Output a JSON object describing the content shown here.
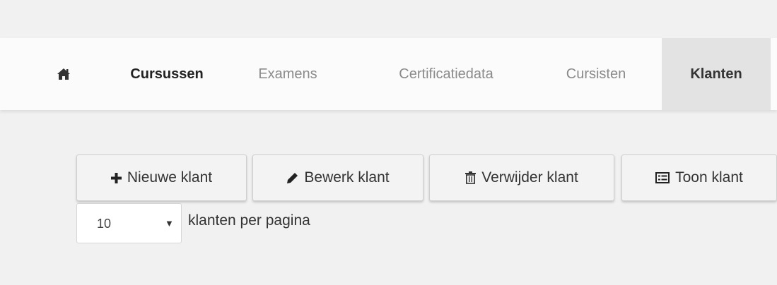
{
  "nav": {
    "home_icon": "home-icon",
    "items": [
      {
        "label": "Cursussen",
        "state": "emphasized"
      },
      {
        "label": "Examens",
        "state": "normal"
      },
      {
        "label": "Certificatiedata",
        "state": "normal"
      },
      {
        "label": "Cursisten",
        "state": "normal"
      },
      {
        "label": "Klanten",
        "state": "active"
      }
    ]
  },
  "toolbar": {
    "new_label": "Nieuwe klant",
    "new_icon": "plus-icon",
    "edit_label": "Bewerk klant",
    "edit_icon": "pencil-icon",
    "delete_label": "Verwijder klant",
    "delete_icon": "trash-icon",
    "show_label": "Toon klant",
    "show_icon": "list-icon"
  },
  "pagination": {
    "per_page_value": "10",
    "per_page_label": "klanten per pagina"
  },
  "colors": {
    "background": "#f1f1f1",
    "navbar": "#fbfbfb",
    "active_tab": "#e3e3e3",
    "button": "#f3f3f3"
  }
}
